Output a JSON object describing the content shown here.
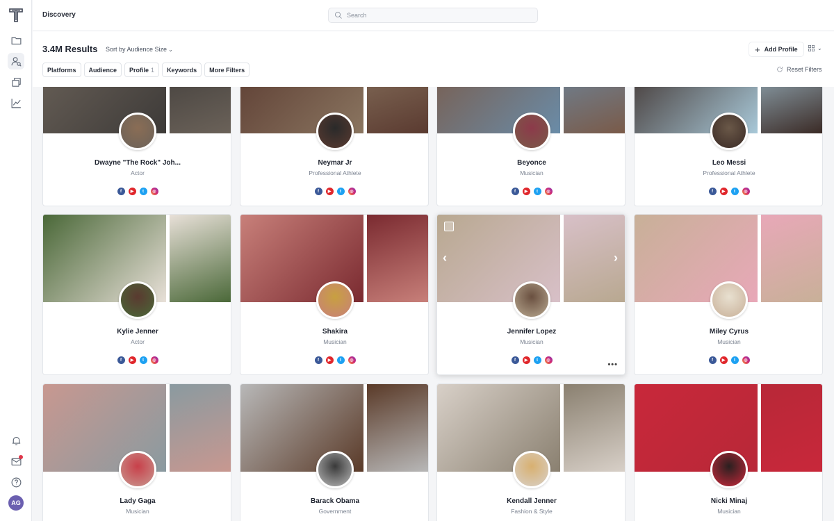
{
  "app": {
    "logo_letter": "T"
  },
  "topbar": {
    "title": "Discovery",
    "search_placeholder": "Search"
  },
  "sidebar": {
    "items": [
      {
        "icon": "folder-icon"
      },
      {
        "icon": "user-search-icon",
        "active": true
      },
      {
        "icon": "layers-icon"
      },
      {
        "icon": "trend-chart-icon"
      }
    ],
    "bottom": [
      {
        "icon": "bell-icon"
      },
      {
        "icon": "mail-icon",
        "has_notification": true
      },
      {
        "icon": "help-icon"
      }
    ],
    "user_initials": "AG"
  },
  "header": {
    "results": "3.4M Results",
    "sort_label": "Sort by Audience Size",
    "add_profile": "Add Profile",
    "reset_filters": "Reset Filters",
    "filters": [
      {
        "label": "Platforms",
        "count": ""
      },
      {
        "label": "Audience",
        "count": ""
      },
      {
        "label": "Profile",
        "count": "1"
      },
      {
        "label": "Keywords",
        "count": ""
      },
      {
        "label": "More Filters",
        "count": ""
      }
    ]
  },
  "profiles": [
    {
      "name": "Dwayne \"The Rock\" Joh...",
      "role": "Actor",
      "colors": [
        "#6b6259",
        "#3d3a38"
      ],
      "avatar": "#8a6d55"
    },
    {
      "name": "Neymar Jr",
      "role": "Professional Athlete",
      "colors": [
        "#5a3a30",
        "#8a7560"
      ],
      "avatar": "#2a2a2a"
    },
    {
      "name": "Beyonce",
      "role": "Musician",
      "colors": [
        "#7a5a48",
        "#6a8ca8"
      ],
      "avatar": "#8c3a4a"
    },
    {
      "name": "Leo Messi",
      "role": "Professional Athlete",
      "colors": [
        "#3a2a25",
        "#a8c8d8"
      ],
      "avatar": "#6a5848"
    },
    {
      "name": "Kylie Jenner",
      "role": "Actor",
      "colors": [
        "#4a6838",
        "#e8e0d8"
      ],
      "avatar": "#5a3a30"
    },
    {
      "name": "Shakira",
      "role": "Musician",
      "colors": [
        "#c8807a",
        "#7a2a30"
      ],
      "avatar": "#c8a040"
    },
    {
      "name": "Jennifer Lopez",
      "role": "Musician",
      "colors": [
        "#b8a890",
        "#d8c0c8"
      ],
      "avatar": "#6a5040"
    },
    {
      "name": "Miley Cyrus",
      "role": "Musician",
      "colors": [
        "#c8b098",
        "#e8a8b8"
      ],
      "avatar": "#e8e0d0"
    },
    {
      "name": "Lady Gaga",
      "role": "Musician",
      "colors": [
        "#c89890",
        "#8a9aa0"
      ],
      "avatar": "#c8404a"
    },
    {
      "name": "Barack Obama",
      "role": "Government",
      "colors": [
        "#b8b8b8",
        "#5a3a28"
      ],
      "avatar": "#3a3a3a"
    },
    {
      "name": "Kendall Jenner",
      "role": "Fashion & Style",
      "colors": [
        "#d8d0c8",
        "#8a8070"
      ],
      "avatar": "#d8b070"
    },
    {
      "name": "Nicki Minaj",
      "role": "Musician",
      "colors": [
        "#c8283a",
        "#b82838"
      ],
      "avatar": "#2a2020"
    }
  ],
  "social_icons": [
    "facebook-icon",
    "youtube-icon",
    "twitter-icon",
    "instagram-icon"
  ]
}
